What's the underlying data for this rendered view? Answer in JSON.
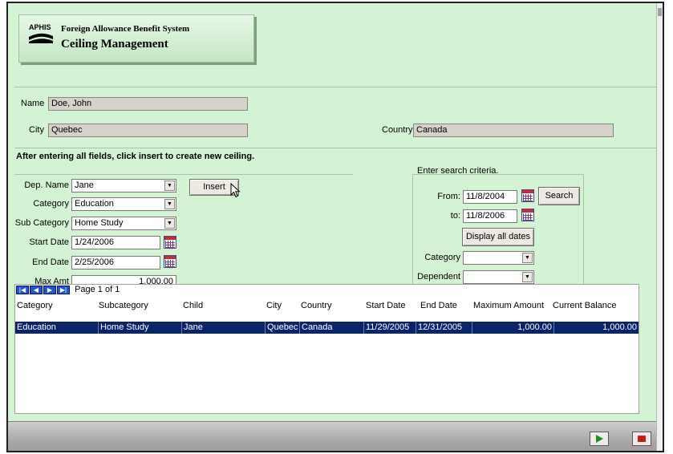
{
  "header": {
    "logo_text": "APHIS",
    "title": "Foreign Allowance Benefit System",
    "subtitle": "Ceiling Management"
  },
  "employee": {
    "name_label": "Name",
    "name_value": "Doe, John",
    "city_label": "City",
    "city_value": "Quebec",
    "country_label": "Country",
    "country_value": "Canada"
  },
  "instruction": "After entering all fields, click insert to create new ceiling.",
  "entry_form": {
    "dep_name_label": "Dep. Name",
    "dep_name_value": "Jane",
    "category_label": "Category",
    "category_value": "Education",
    "sub_category_label": "Sub Category",
    "sub_category_value": "Home Study",
    "start_date_label": "Start Date",
    "start_date_value": "1/24/2006",
    "end_date_label": "End Date",
    "end_date_value": "2/25/2006",
    "max_amt_label": "Max Amt",
    "max_amt_value": "1,000.00",
    "insert_label": "Insert"
  },
  "search": {
    "legend": "Enter search criteria.",
    "from_label": "From:",
    "from_value": "11/8/2004",
    "to_label": "to:",
    "to_value": "11/8/2006",
    "search_label": "Search",
    "display_all_label": "Display all dates",
    "category_label": "Category",
    "category_value": "",
    "dependent_label": "Dependent",
    "dependent_value": ""
  },
  "table": {
    "page_text": "Page 1 of 1",
    "columns": [
      "Category",
      "Subcategory",
      "Child",
      "City",
      "Country",
      "Start Date",
      "End Date",
      "Maximum Amount",
      "Current Balance"
    ],
    "rows": [
      [
        "Education",
        "Home Study",
        "Jane",
        "Quebec",
        "Canada",
        "11/29/2005",
        "12/31/2005",
        "1,000.00",
        "1,000.00"
      ]
    ]
  },
  "colors": {
    "background": "#d4f2d4",
    "selected_row": "#0a246a"
  },
  "icons": [
    "calendar-icon",
    "first-page-icon",
    "prev-page-icon",
    "next-page-icon",
    "last-page-icon",
    "play-icon",
    "stop-icon",
    "dropdown-arrow-icon"
  ]
}
